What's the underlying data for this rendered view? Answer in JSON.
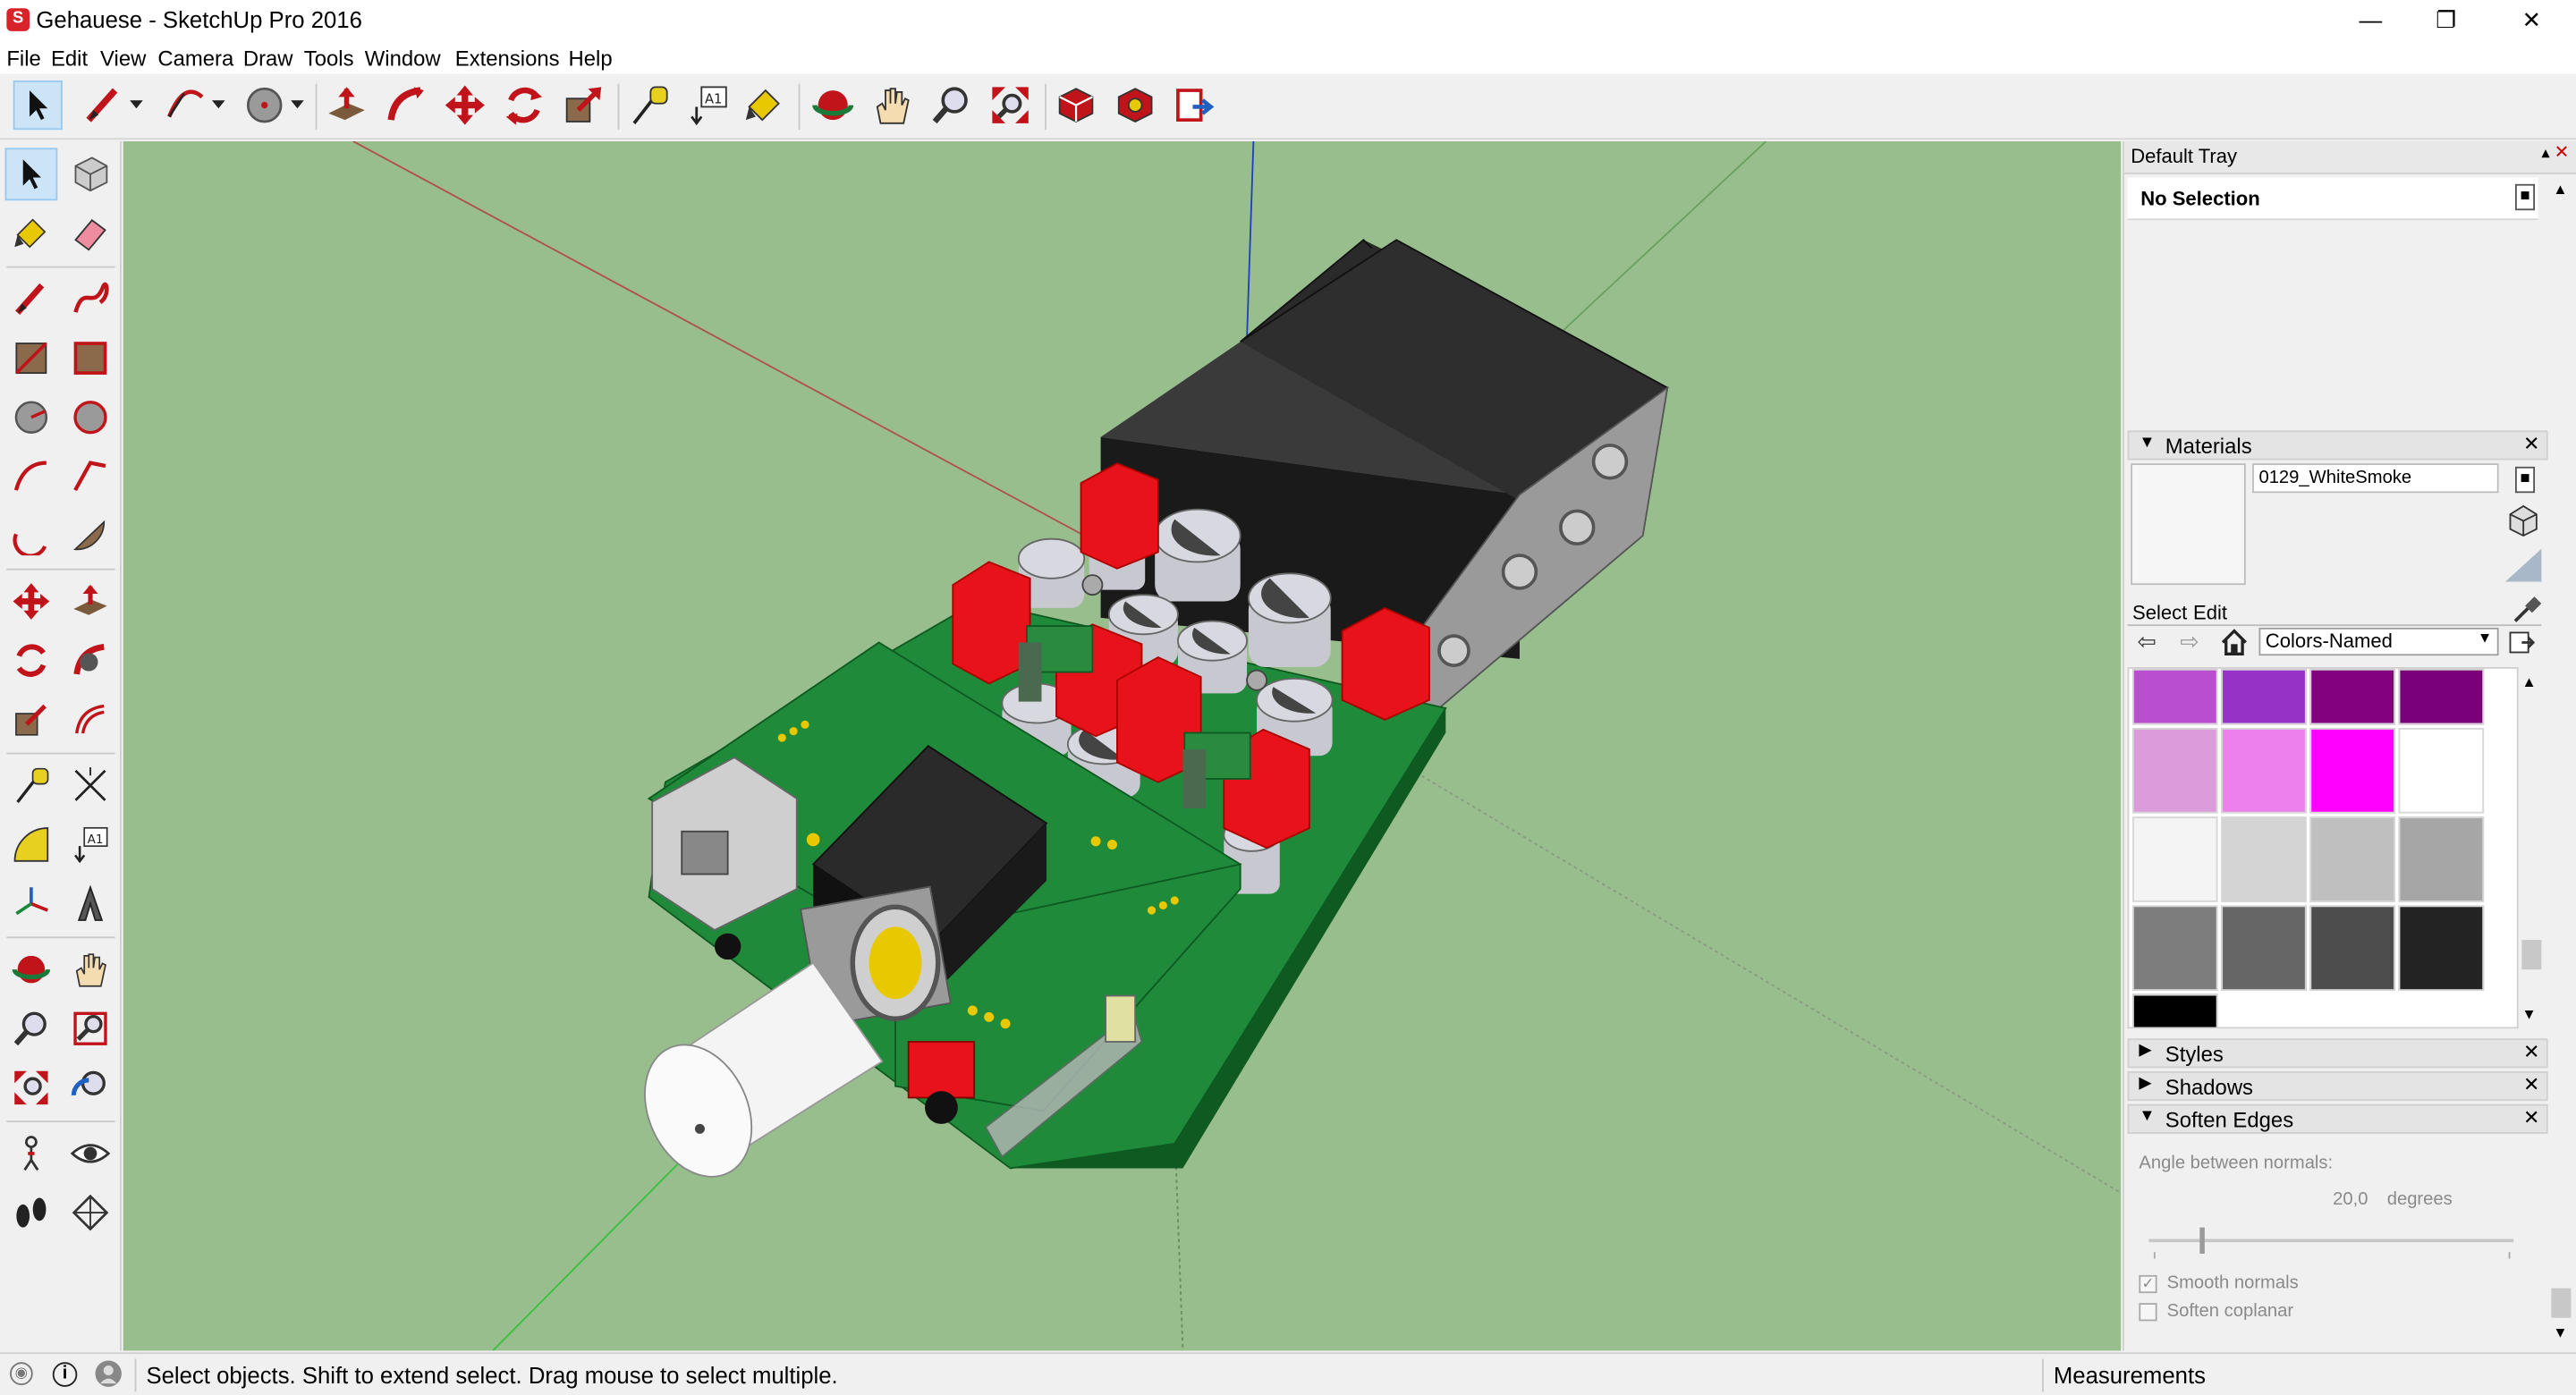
{
  "window": {
    "title": "Gehauese - SketchUp Pro 2016",
    "minimize": "—",
    "restore": "❐",
    "close": "✕"
  },
  "menu": [
    "File",
    "Edit",
    "View",
    "Camera",
    "Draw",
    "Tools",
    "Window",
    "Extensions",
    "Help"
  ],
  "tray": {
    "title": "Default Tray",
    "entity_info": "No Selection",
    "materials": {
      "header": "Materials",
      "material_name": "0129_WhiteSmoke",
      "tab_select": "Select",
      "tab_edit": "Edit",
      "library": "Colors-Named",
      "swatches": [
        "#b94fd0",
        "#9632c6",
        "#83007f",
        "#7a0079",
        "#dc9cdc",
        "#ed80ed",
        "#ff00ff",
        "#ffffff",
        "#f4f4f4",
        "#d4d4d4",
        "#bfbfbf",
        "#a6a6a6",
        "#7d7d7d",
        "#666666",
        "#4d4d4d",
        "#232323",
        "#000000"
      ]
    },
    "styles": "Styles",
    "shadows": "Shadows",
    "soften_edges": {
      "header": "Soften Edges",
      "angle_label": "Angle between normals:",
      "angle_value": "20,0",
      "angle_unit": "degrees",
      "smooth_normals": "Smooth normals",
      "soften_coplanar": "Soften coplanar",
      "smooth_checked": true,
      "coplanar_checked": false
    }
  },
  "status": {
    "message": "Select objects. Shift to extend select. Drag mouse to select multiple.",
    "measurements_label": "Measurements"
  },
  "colors": {
    "viewport_bg": "#98be8d",
    "pcb_green": "#1e8a3a",
    "part_red": "#e8121a",
    "box_black": "#1a1a1a"
  }
}
